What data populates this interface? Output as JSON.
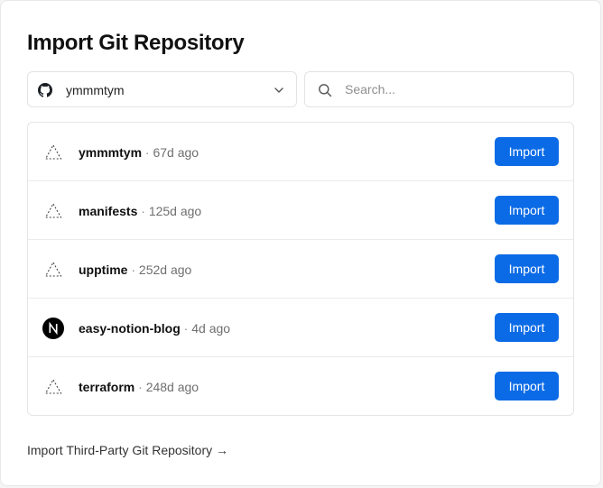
{
  "title": "Import Git Repository",
  "account_select": {
    "value": "ymmmtym",
    "icon": "github-icon",
    "chevron_icon": "chevron-down-icon"
  },
  "search": {
    "placeholder": "Search...",
    "value": "",
    "icon": "search-icon"
  },
  "separator": "·",
  "repos": [
    {
      "name": "ymmmtym",
      "time": "67d ago",
      "icon": "framework-placeholder-icon"
    },
    {
      "name": "manifests",
      "time": "125d ago",
      "icon": "framework-placeholder-icon"
    },
    {
      "name": "upptime",
      "time": "252d ago",
      "icon": "framework-placeholder-icon"
    },
    {
      "name": "easy-notion-blog",
      "time": "4d ago",
      "icon": "nextjs-icon"
    },
    {
      "name": "terraform",
      "time": "248d ago",
      "icon": "framework-placeholder-icon"
    }
  ],
  "import_label": "Import",
  "third_party_link": "Import Third-Party Git Repository →",
  "colors": {
    "accent": "#0b6be6",
    "border": "#e5e5e5",
    "muted_text": "#6f6f6f"
  }
}
